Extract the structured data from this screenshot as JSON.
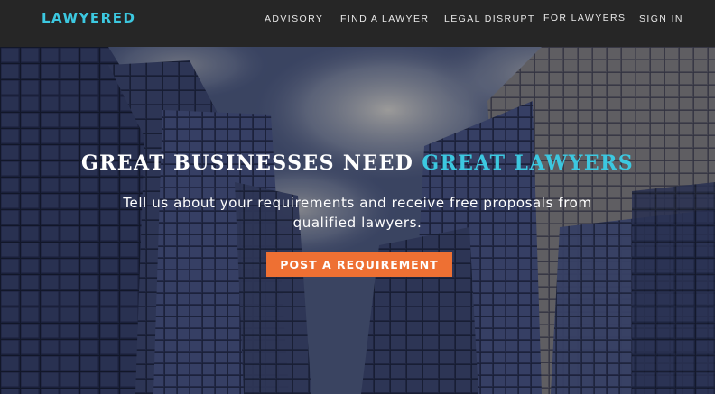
{
  "brand": {
    "logo_text": "LAWYERED",
    "accent_color": "#3cc8e0",
    "nav_background": "#262626"
  },
  "nav": {
    "items": [
      {
        "label": "ADVISORY"
      },
      {
        "label": "FIND A LAWYER"
      },
      {
        "label": "LEGAL DISRUPT"
      },
      {
        "label": "FOR LAWYERS"
      },
      {
        "label": "SIGN IN"
      }
    ]
  },
  "hero": {
    "headline_part1": "GREAT BUSINESSES NEED",
    "headline_part2": "GREAT LAWYERS",
    "subtitle": "Tell us about your requirements and receive free proposals from qualified lawyers.",
    "cta_label": "POST A REQUIREMENT",
    "cta_color": "#ee7033"
  }
}
